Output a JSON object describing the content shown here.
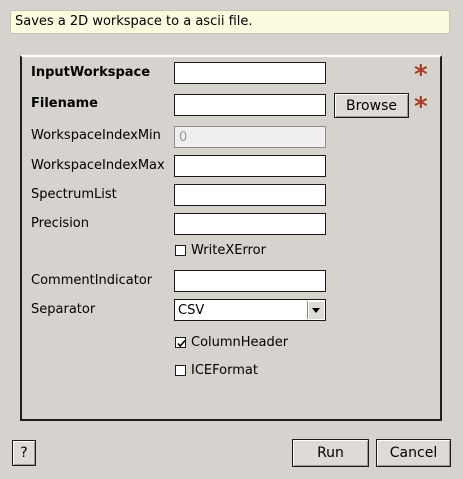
{
  "description": "Saves a 2D workspace to a ascii file.",
  "fields": {
    "input_workspace": {
      "label": "InputWorkspace",
      "value": ""
    },
    "filename": {
      "label": "Filename",
      "value": ""
    },
    "ws_index_min": {
      "label": "WorkspaceIndexMin",
      "placeholder": "0"
    },
    "ws_index_max": {
      "label": "WorkspaceIndexMax",
      "value": ""
    },
    "spectrum_list": {
      "label": "SpectrumList",
      "value": ""
    },
    "precision": {
      "label": "Precision",
      "value": ""
    },
    "comment_indicator": {
      "label": "CommentIndicator",
      "value": ""
    },
    "separator": {
      "label": "Separator",
      "selected": "CSV"
    }
  },
  "checkboxes": {
    "write_x_error": {
      "label": "WriteXError",
      "checked": false
    },
    "column_header": {
      "label": "ColumnHeader",
      "checked": true
    },
    "ice_format": {
      "label": "ICEFormat",
      "checked": false
    }
  },
  "required_mark": "*",
  "buttons": {
    "browse": "Browse",
    "help": "?",
    "run": "Run",
    "cancel": "Cancel"
  },
  "colors": {
    "required_star": "#a83c28",
    "description_bg": "#fbfbdf",
    "window_bg": "#d6d2ce"
  }
}
